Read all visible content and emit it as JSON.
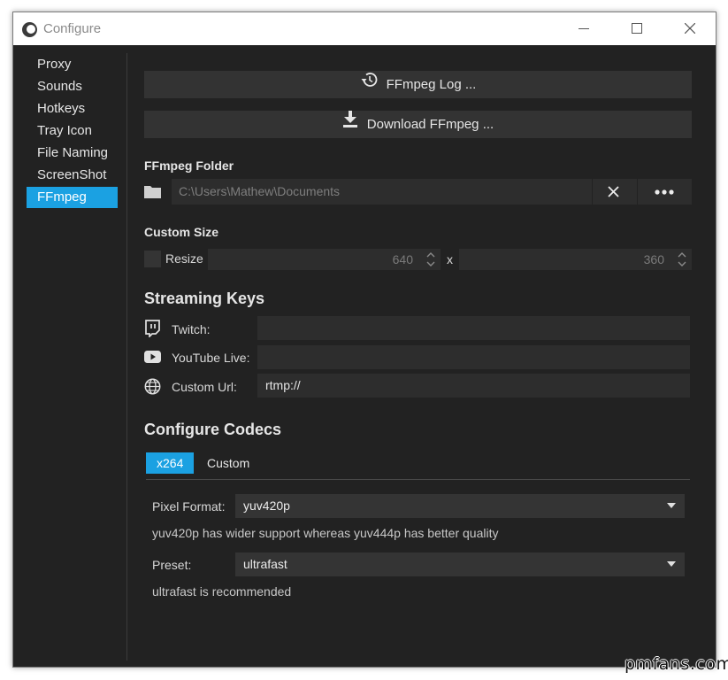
{
  "window": {
    "title": "Configure"
  },
  "sidebar": {
    "items": [
      {
        "label": "Proxy"
      },
      {
        "label": "Sounds"
      },
      {
        "label": "Hotkeys"
      },
      {
        "label": "Tray Icon"
      },
      {
        "label": "File Naming"
      },
      {
        "label": "ScreenShot"
      },
      {
        "label": "FFmpeg",
        "active": true
      }
    ]
  },
  "ffmpeg": {
    "log_button": "FFmpeg Log ...",
    "download_button": "Download FFmpeg ...",
    "folder_label": "FFmpeg Folder",
    "folder_path": "C:\\Users\\Mathew\\Documents"
  },
  "custom_size": {
    "label": "Custom Size",
    "resize_label": "Resize",
    "resize_checked": false,
    "width": "640",
    "separator": "x",
    "height": "360"
  },
  "streaming_keys": {
    "heading": "Streaming Keys",
    "twitch_label": "Twitch:",
    "twitch_value": "",
    "youtube_label": "YouTube Live:",
    "youtube_value": "",
    "custom_label": "Custom Url:",
    "custom_value": "rtmp://"
  },
  "codecs": {
    "heading": "Configure Codecs",
    "tabs": [
      {
        "label": "x264",
        "active": true
      },
      {
        "label": "Custom"
      }
    ],
    "pixel_format_label": "Pixel Format:",
    "pixel_format_value": "yuv420p",
    "pixel_format_hint": "yuv420p has wider support whereas yuv444p has better quality",
    "preset_label": "Preset:",
    "preset_value": "ultrafast",
    "preset_hint": "ultrafast is recommended"
  },
  "watermark": "pmfans.com",
  "colors": {
    "accent": "#1ba1e2",
    "background": "#222222",
    "control": "#2d2d2d"
  },
  "icons": [
    "history-icon",
    "download-icon",
    "folder-icon",
    "close-icon",
    "more-icon",
    "twitch-icon",
    "youtube-icon",
    "globe-icon",
    "chevron-down-icon"
  ]
}
